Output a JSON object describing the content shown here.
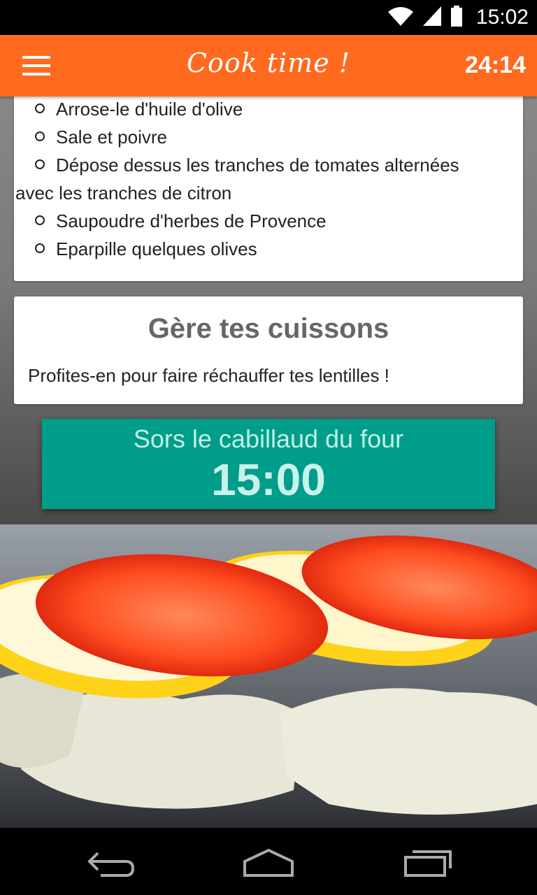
{
  "status_bar": {
    "time": "15:02",
    "icons": [
      "wifi-icon",
      "signal-icon",
      "battery-icon"
    ]
  },
  "app_bar": {
    "title": "Cook time !",
    "timer": "24:14",
    "menu_icon": "hamburger-menu-icon",
    "background_color": "#ff6a1f"
  },
  "steps": [
    {
      "text": "Arrose-le d'huile d'olive"
    },
    {
      "text": "Sale et poivre"
    },
    {
      "text": "Dépose dessus les tranches de tomates alternées"
    },
    {
      "text": "avec les tranches de citron"
    },
    {
      "text": "Saupoudre d'herbes de Provence"
    },
    {
      "text": "Eparpille quelques olives"
    }
  ],
  "cuisson": {
    "title": "Gère tes cuissons",
    "text": "Profites-en pour faire réchauffer tes lentilles !"
  },
  "timer": {
    "label": "Sors le cabillaud du four",
    "value": "15:00",
    "color": "#009d8a"
  },
  "nav_bar": {
    "icons": [
      "back-icon",
      "home-icon",
      "recent-apps-icon"
    ]
  }
}
